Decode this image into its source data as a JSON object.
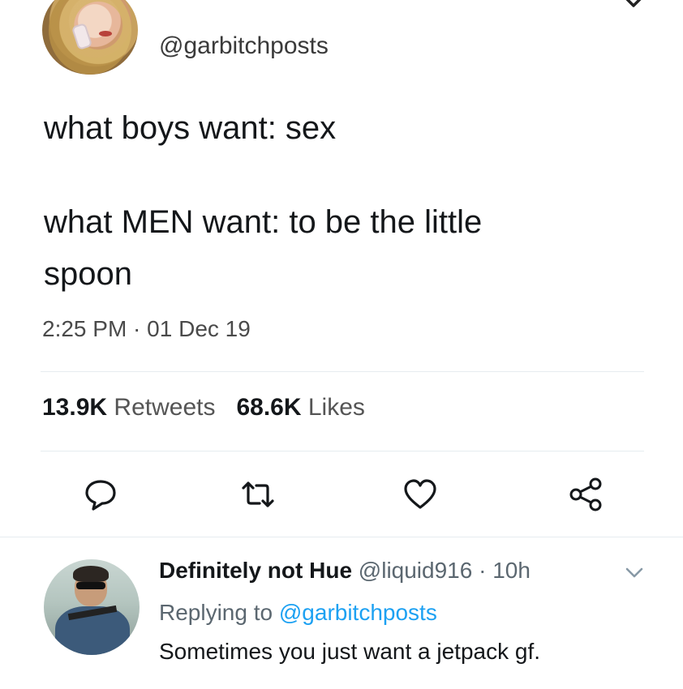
{
  "author": {
    "handle": "@garbitchposts",
    "avatar": "woman-with-phone-avatar"
  },
  "tweet": {
    "line1": "what boys want: sex",
    "line2": "what MEN want: to be the little",
    "line3": "spoon",
    "time": "2:25 PM",
    "separator": " · ",
    "date": "01 Dec 19"
  },
  "stats": {
    "retweets_count": "13.9K",
    "retweets_label": "Retweets",
    "likes_count": "68.6K",
    "likes_label": "Likes"
  },
  "actions": {
    "icons": [
      "reply-icon",
      "retweet-icon",
      "like-icon",
      "share-icon"
    ],
    "icon_color": "#14171a"
  },
  "reply": {
    "name": "Definitely not Hue",
    "handle": "@liquid916",
    "separator": " · ",
    "age": "10h",
    "replying_prefix": "Replying to",
    "replying_to": "@garbitchposts",
    "text": "Sometimes you just want a jetpack gf.",
    "avatar": "man-with-sunglasses-avatar"
  },
  "colors": {
    "link": "#1da1f2",
    "divider": "#e6ecf0",
    "secondary_text": "#5b6770"
  }
}
